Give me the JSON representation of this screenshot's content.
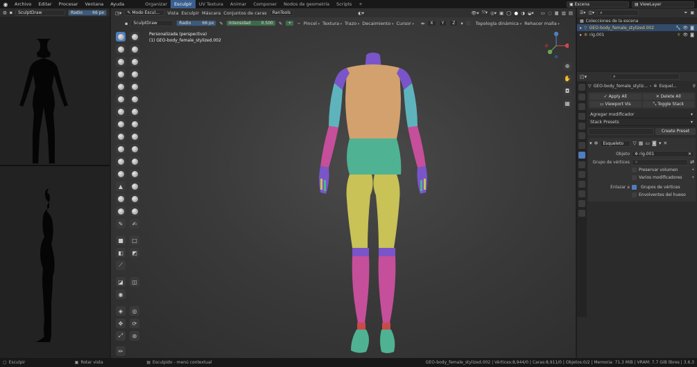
{
  "menubar": {
    "items": [
      "Archivo",
      "Editar",
      "Procesar",
      "Ventana",
      "Ayuda"
    ],
    "workspaces": [
      {
        "label": "Organizar",
        "active": false
      },
      {
        "label": "Esculpir",
        "active": true
      },
      {
        "label": "UV Textura",
        "active": false
      },
      {
        "label": "Animar",
        "active": false
      },
      {
        "label": "Componer",
        "active": false
      },
      {
        "label": "Nodos de geometría",
        "active": false
      },
      {
        "label": "Scripts",
        "active": false
      }
    ],
    "add_tab": "+",
    "scene_name": "Escena",
    "view_layer": "ViewLayer"
  },
  "left_header": {
    "brush_name": "SculptDraw",
    "radius_label": "Radio",
    "radius_value": "66 px"
  },
  "viewport_header": {
    "mode": "Modo Escul...",
    "menus": [
      "Vista",
      "Esculpir",
      "Máscara",
      "Conjuntos de caras",
      "RanTools"
    ]
  },
  "tool_header": {
    "brush_name": "SculptDraw",
    "radius_label": "Radio",
    "radius_value": "66 px",
    "strength_label": "Intensidad",
    "strength_value": "0.500",
    "menus": [
      "Pincel",
      "Textura",
      "Trazo",
      "Decaimiento",
      "Cursor"
    ],
    "axes": [
      "X",
      "Y",
      "Z"
    ],
    "dyntopo": "Topología dinámica",
    "remesh": "Rehacer malla"
  },
  "viewport_info": {
    "line1": "Personalizada (perspectiva)",
    "line2": "(1) GEO-body_female_stylized.002"
  },
  "outliner": {
    "title": "Colecciones de la escena",
    "items": [
      {
        "name": "GEO-body_female_stylized.002",
        "selected": true
      },
      {
        "name": "rig.001",
        "selected": false
      }
    ]
  },
  "properties": {
    "breadcrumb_obj": "GEO-body_female_styliz...",
    "breadcrumb_mod": "Esquel...",
    "apply_all": "Apply All",
    "delete_all": "Delete All",
    "viewport_vis": "Viewport Vis",
    "toggle_stack": "Toggle Stack",
    "add_modifier": "Agregar modificador",
    "stack_presets": "Stack Presets",
    "create_preset": "Create Preset",
    "modifier_name": "Esqueleto",
    "object_label": "Objeto",
    "object_value": "rig.001",
    "vgroup_label": "Grupo de vértices",
    "preserve_volume": "Preservar volumen",
    "multi_modifier": "Varios modificadores",
    "bind_to_label": "Enlazar a",
    "vertex_groups": "Grupos de vértices",
    "bone_envelopes": "Envolventes del hueso"
  },
  "statusbar": {
    "left": "Esculpir",
    "middle": "Rotar vista",
    "context": "Esculpido - menú contextual",
    "stats": "GEO-body_female_stylized.002 | Vértices:8,944/0 | Caras:8,911/0 | Objetos:0/2 | Memoria: 71.3 MiB | VRAM: 7.7 GiB libres | 3.6.3"
  },
  "colors": {
    "accent": "#4f7dbe",
    "skin": "#d2a16e",
    "purple": "#7a55c9",
    "cyan": "#5fb3bd",
    "magenta": "#c54f9a",
    "yellow": "#c8c257",
    "teal": "#4fb293",
    "red": "#c94a4a"
  }
}
